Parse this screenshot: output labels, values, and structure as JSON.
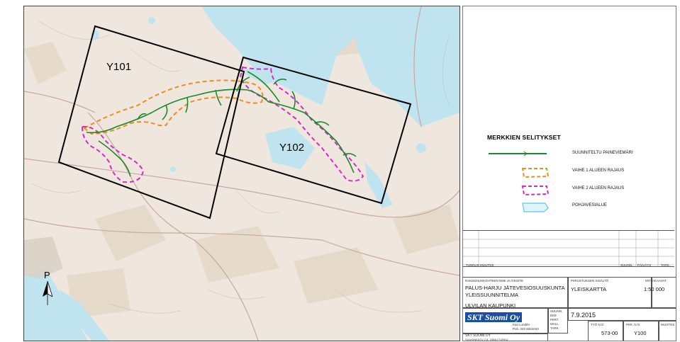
{
  "map": {
    "area_labels": [
      "Y101",
      "Y102"
    ],
    "north_label": "P"
  },
  "legend": {
    "title": "MERKKIEN SELITYKSET",
    "items": [
      {
        "label": "SUUNNITELTU PAINEVIEMÄRI",
        "color": "#1a8a2a",
        "icon": "pipeline-line"
      },
      {
        "label": "VAIHE 1 ALUEEN RAJAUS",
        "color": "#f08c1e",
        "icon": "dashed-area-orange"
      },
      {
        "label": "VAIHE 2 ALUEEN RAJAUS",
        "color": "#d62ac8",
        "icon": "dashed-area-magenta"
      },
      {
        "label": "POHJAVESIALUE",
        "color": "#5ac8e6",
        "icon": "groundwater-area"
      }
    ]
  },
  "revision_table": {
    "headers": [
      "TUNNUS",
      "MUUTOS",
      "SUUNN.",
      "PÄIVÄYS",
      "TARK."
    ]
  },
  "title_block": {
    "project_label": "RAKENNUSKOHTEEN NIMI JA OSOITE",
    "project_line1": "PALUS-HARJU JÄTEVESIOSUUSKUNTA",
    "project_line2": "YLEISSUUNNITELMA",
    "content_label": "PIIRUSTUKSEN SISÄLTÖ",
    "content": "YLEISKARTTA",
    "scale_label": "MITTAKAAVAT",
    "scale": "1:50 000",
    "municipality": "ULVILAN KAUPUNKI",
    "company_logo": "SKT Suomi Oy",
    "contact_name": "Kati Lundén",
    "contact_phone": "Puh. 040 8201043",
    "role_labels": [
      "SUUNN.",
      "EKE",
      "PIIRT.",
      "MALL",
      "TARK."
    ],
    "date": "7.9.2015",
    "company_name": "SKT SUOMI OY",
    "company_address": "SUUKINKATU 2 A, 20540 TURKU",
    "work_no_label": "TYÖ N:O",
    "work_no": "573-00",
    "drawing_no_label": "PIIR. N:O",
    "drawing_no": "Y100",
    "change_label": "MUUTOS"
  },
  "colors": {
    "pipeline": "#1a8a2a",
    "phase1": "#f08c1e",
    "phase2": "#d62ac8",
    "groundwater": "#5ac8e6",
    "water": "#b8e2ee",
    "land": "#eee6dc"
  }
}
